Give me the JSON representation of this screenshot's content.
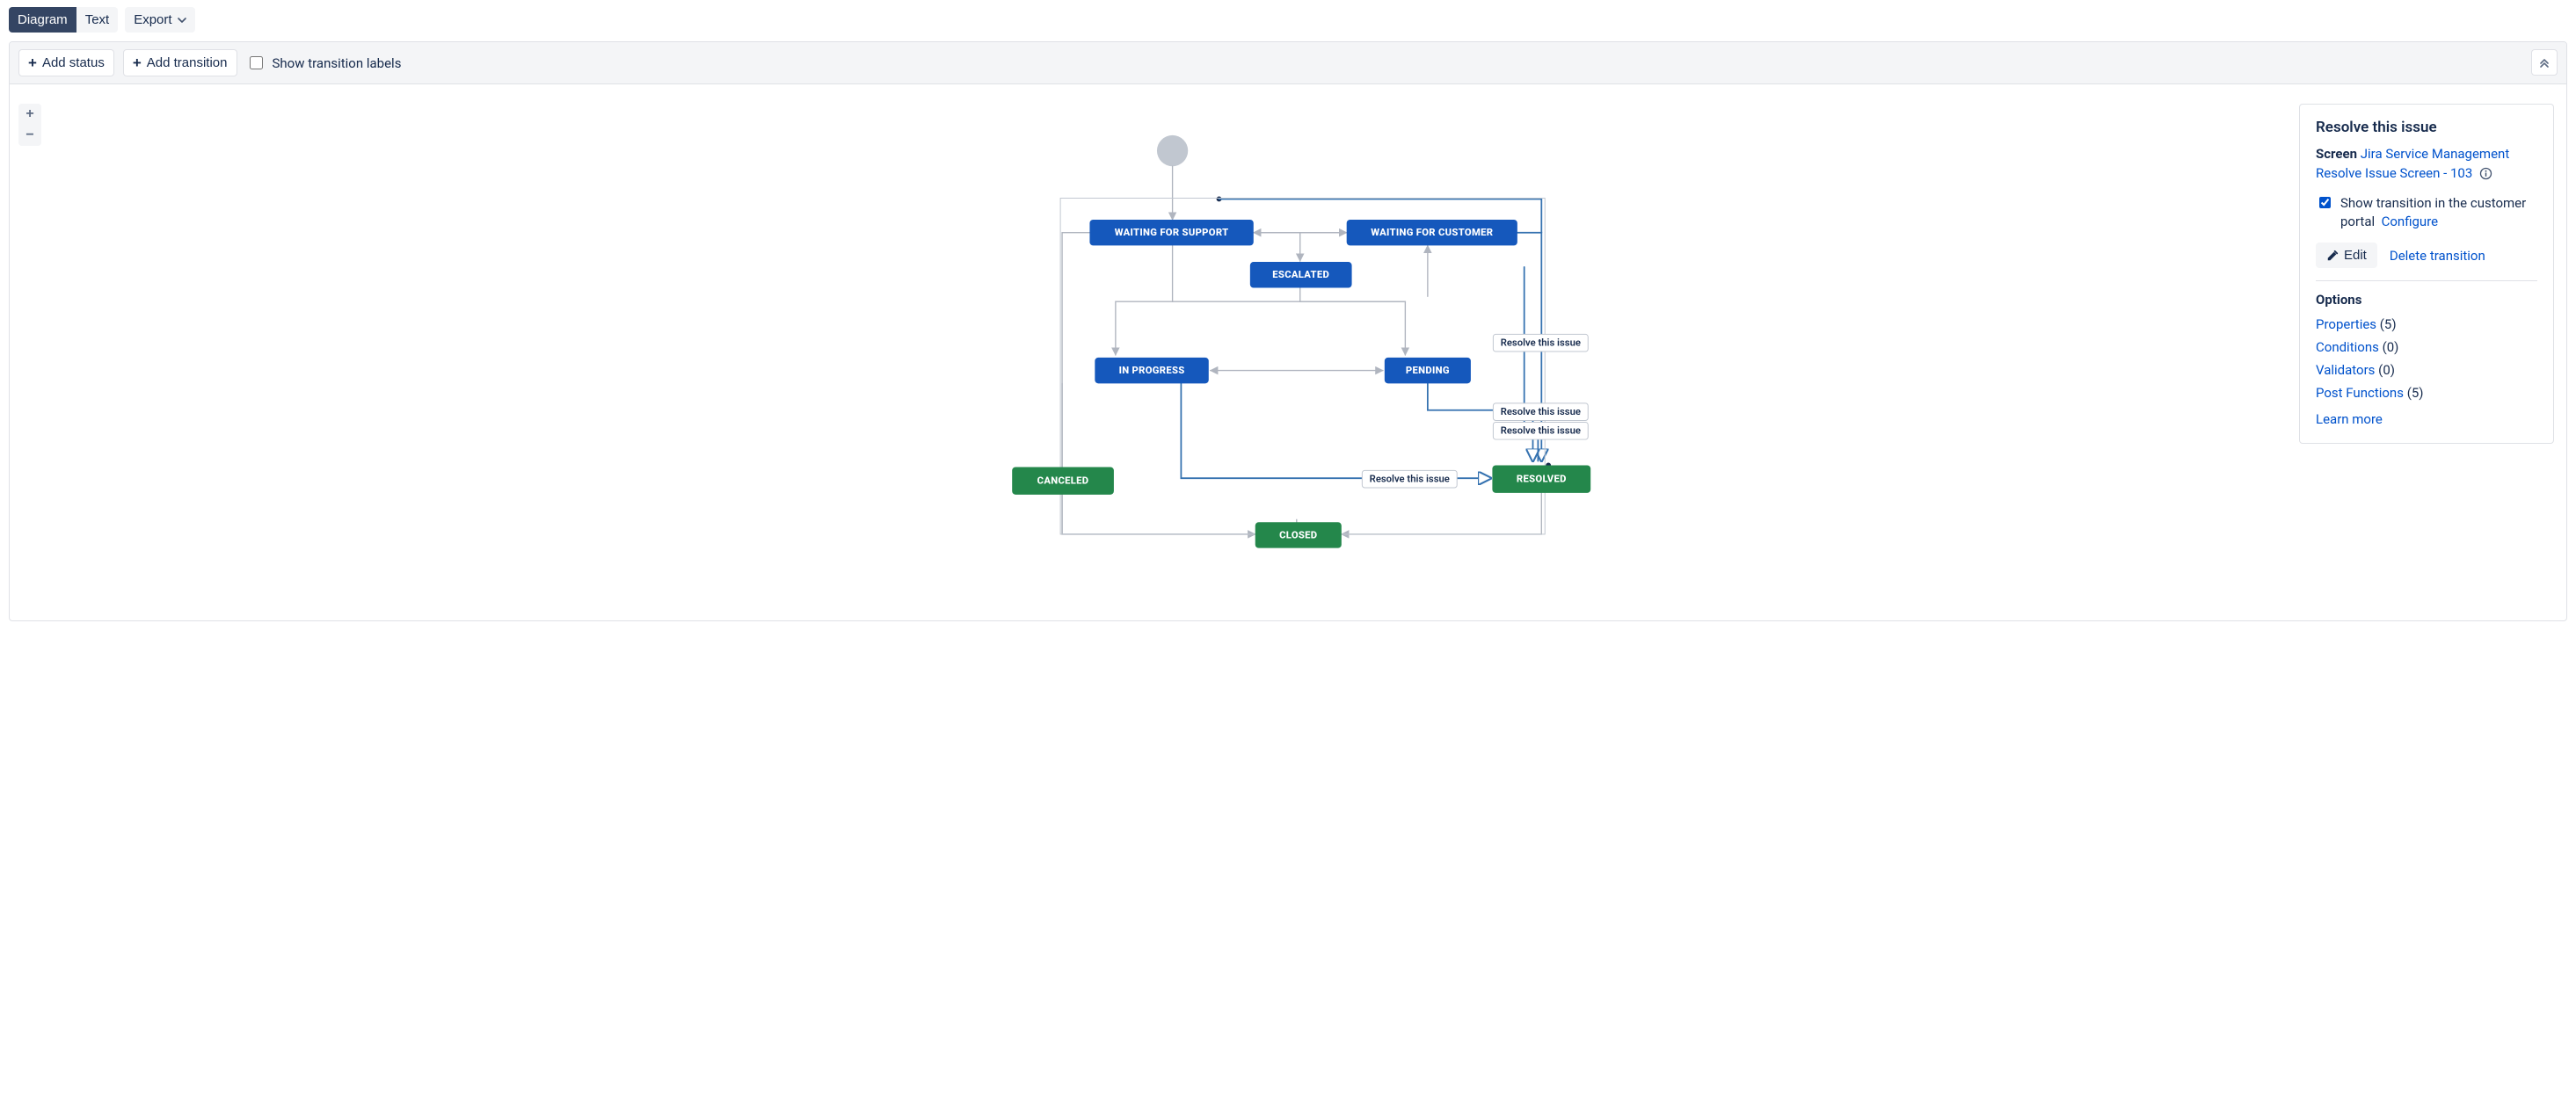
{
  "toolbar": {
    "view_diagram": "Diagram",
    "view_text": "Text",
    "export": "Export"
  },
  "canvas_toolbar": {
    "add_status": "Add status",
    "add_transition": "Add transition",
    "show_transition_labels": "Show transition labels",
    "show_transition_labels_checked": false
  },
  "statuses": {
    "waiting_for_support": "WAITING FOR SUPPORT",
    "waiting_for_customer": "WAITING FOR CUSTOMER",
    "escalated": "ESCALATED",
    "in_progress": "IN PROGRESS",
    "pending": "PENDING",
    "canceled": "CANCELED",
    "resolved": "RESOLVED",
    "closed": "CLOSED"
  },
  "status_categories": {
    "waiting_for_support": "in-progress",
    "waiting_for_customer": "in-progress",
    "escalated": "in-progress",
    "in_progress": "in-progress",
    "pending": "in-progress",
    "canceled": "done",
    "resolved": "done",
    "closed": "done"
  },
  "category_colors": {
    "in-progress": "#1558BC",
    "done": "#24874B"
  },
  "transition_labels": {
    "resolve1": "Resolve this issue",
    "resolve2": "Resolve this issue",
    "resolve3": "Resolve this issue",
    "resolve4": "Resolve this issue"
  },
  "panel": {
    "title": "Resolve this issue",
    "screen_label": "Screen",
    "screen_name": "Jira Service Management Resolve Issue Screen - 103",
    "show_in_portal": "Show transition in the customer portal",
    "show_in_portal_checked": true,
    "configure": "Configure",
    "edit": "Edit",
    "delete_transition": "Delete transition",
    "options_title": "Options",
    "options": [
      {
        "label": "Properties",
        "count": 5
      },
      {
        "label": "Conditions",
        "count": 0
      },
      {
        "label": "Validators",
        "count": 0
      },
      {
        "label": "Post Functions",
        "count": 5
      }
    ],
    "learn_more": "Learn more"
  },
  "chart_data": {
    "type": "diagram",
    "title": "Workflow transitions diagram",
    "nodes": [
      {
        "id": "start",
        "type": "initial"
      },
      {
        "id": "waiting_for_support",
        "label": "WAITING FOR SUPPORT",
        "category": "in-progress"
      },
      {
        "id": "waiting_for_customer",
        "label": "WAITING FOR CUSTOMER",
        "category": "in-progress"
      },
      {
        "id": "escalated",
        "label": "ESCALATED",
        "category": "in-progress"
      },
      {
        "id": "in_progress",
        "label": "IN PROGRESS",
        "category": "in-progress"
      },
      {
        "id": "pending",
        "label": "PENDING",
        "category": "in-progress"
      },
      {
        "id": "canceled",
        "label": "CANCELED",
        "category": "done"
      },
      {
        "id": "resolved",
        "label": "RESOLVED",
        "category": "done"
      },
      {
        "id": "closed",
        "label": "CLOSED",
        "category": "done"
      }
    ],
    "edges": [
      {
        "from": "start",
        "to": "waiting_for_support"
      },
      {
        "from": "waiting_for_support",
        "to": "waiting_for_customer",
        "bidirectional": true
      },
      {
        "from": "waiting_for_support",
        "to": "escalated"
      },
      {
        "from": "waiting_for_support",
        "to": "in_progress"
      },
      {
        "from": "escalated",
        "to": "waiting_for_customer"
      },
      {
        "from": "waiting_for_customer",
        "to": "pending"
      },
      {
        "from": "in_progress",
        "to": "pending",
        "bidirectional": true
      },
      {
        "from": "waiting_for_support",
        "to": "canceled"
      },
      {
        "from": "waiting_for_customer",
        "to": "resolved",
        "label": "Resolve this issue",
        "selected": true
      },
      {
        "from": "pending",
        "to": "resolved",
        "label": "Resolve this issue",
        "selected": true
      },
      {
        "from": "escalated",
        "to": "resolved",
        "label": "Resolve this issue",
        "selected": true
      },
      {
        "from": "in_progress",
        "to": "resolved",
        "label": "Resolve this issue",
        "selected": true
      },
      {
        "from": "resolved",
        "to": "closed"
      },
      {
        "from": "canceled",
        "to": "closed"
      }
    ]
  }
}
